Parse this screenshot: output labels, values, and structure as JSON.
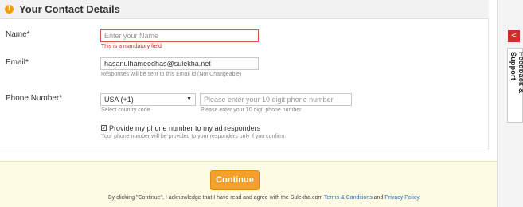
{
  "section": {
    "title": "Your Contact Details",
    "icon": "info-icon"
  },
  "form": {
    "name": {
      "label": "Name*",
      "placeholder": "Enter your Name",
      "error": "This is a mandatory field"
    },
    "email": {
      "label": "Email*",
      "value": "hasanulhameedhas@sulekha.net",
      "hint": "Responses will be sent to this Email id (Not Changeable)"
    },
    "phone": {
      "label": "Phone Number*",
      "country_value": "USA (+1)",
      "country_hint": "Select country code",
      "placeholder": "Please enter your 10 digit phone number",
      "hint": "Please enter your 10 digit phone number"
    },
    "provide_phone": {
      "checked": true,
      "label": "Provide my phone number to my ad responders",
      "hint": "Your phone number will be provided to your responders only if you confirm."
    }
  },
  "footer": {
    "continue_label": "Continue",
    "agree_prefix": "By clicking \"Continue\", I acknowledge that I have read and agree with the Sulekha.com ",
    "terms_link": "Terms & Conditions",
    "agree_and": " and ",
    "privacy_link": "Privacy Policy",
    "agree_suffix": "."
  },
  "sidebar": {
    "share_icon": "share-icon",
    "feedback_label": "Feedback & Support"
  }
}
